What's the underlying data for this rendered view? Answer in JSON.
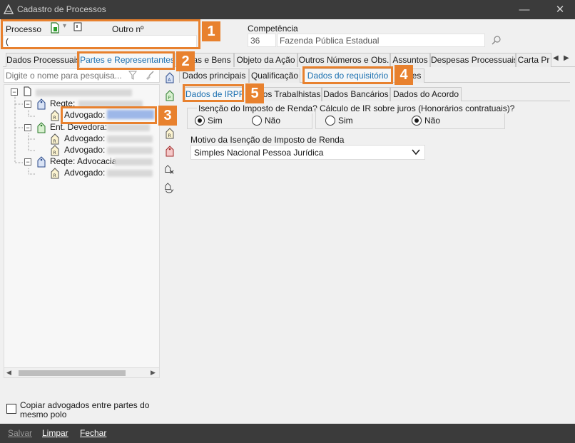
{
  "window": {
    "title": "Cadastro de Processos",
    "minimize": "—",
    "close": "✕"
  },
  "header": {
    "processo_label": "Processo",
    "outro_label": "Outro nº",
    "processo_value": "(",
    "competencia_label": "Competência",
    "competencia_code": "36",
    "competencia_name": "Fazenda Pública Estadual"
  },
  "main_tabs": [
    "Dados Processuais",
    "Partes e Representantes",
    "as e Bens",
    "Objeto da Ação",
    "Outros Números e Obs.",
    "Assuntos",
    "Despesas Processuais",
    "Carta Pr"
  ],
  "search": {
    "placeholder": "Digite o nome para pesquisa..."
  },
  "tree": {
    "reqte1": "Reqte:",
    "advogado1": "Advogado:",
    "ent_devedora": "Ent. Devedora:",
    "advogado2": "Advogado:",
    "advogado3": "Advogado:",
    "reqte2": "Reqte: Advocacia",
    "advogado4": "Advogado:"
  },
  "sub_tabs": [
    "Dados principais",
    "Qualificação",
    "Dados do requisitório",
    "es"
  ],
  "inner_tabs": [
    "Dados de IRPF",
    "os Trabalhistas",
    "Dados Bancários",
    "Dados do Acordo"
  ],
  "irpf": {
    "isencao_label": "Isenção do Imposto de Renda?",
    "calculo_label": "Cálculo de IR sobre juros (Honorários contratuais)?",
    "sim": "Sim",
    "nao": "Não",
    "isencao_value": "Sim",
    "calculo_value": "Não",
    "motivo_label": "Motivo da Isenção de Imposto de Renda",
    "motivo_value": "Simples Nacional Pessoa Jurídica"
  },
  "copy_checkbox": "Copiar advogados entre partes do mesmo polo",
  "footer": {
    "salvar": "Salvar",
    "limpar": "Limpar",
    "fechar": "Fechar"
  },
  "callouts": [
    "1",
    "2",
    "3",
    "4",
    "5"
  ],
  "colors": {
    "accent": "#e8812e",
    "titlebar": "#3b3b3b",
    "active_tab_text": "#1a6fb0"
  }
}
